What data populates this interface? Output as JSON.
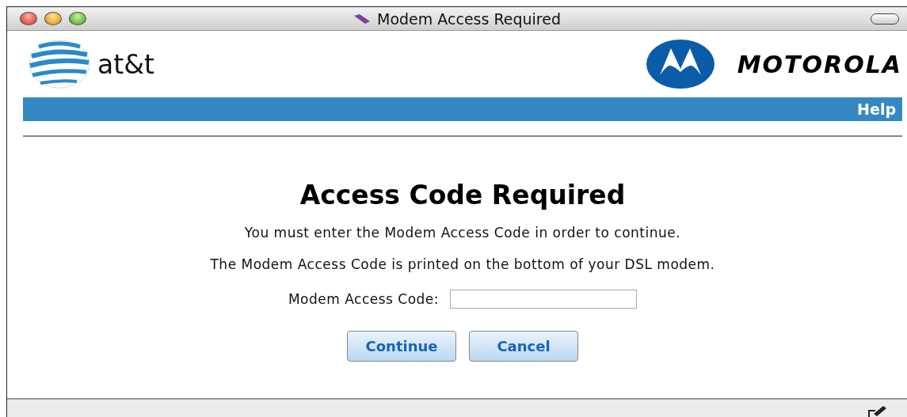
{
  "window": {
    "title": "Modem Access Required"
  },
  "header": {
    "left_logo": "at&t",
    "right_logo": "MOTOROLA",
    "nav_links": [
      "Help"
    ]
  },
  "content": {
    "heading": "Access Code Required",
    "paragraphs": [
      "You must enter the Modem Access Code in order to continue.",
      "The Modem Access Code is printed on the bottom of your DSL modem."
    ],
    "field": {
      "label": "Modem Access Code:"
    },
    "buttons": [
      "Continue",
      "Cancel"
    ]
  }
}
